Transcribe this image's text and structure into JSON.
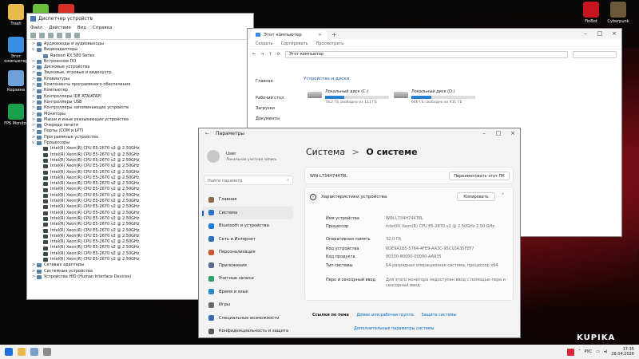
{
  "desktop": {
    "icons_left": [
      {
        "label": "Trash",
        "color": "#e8b84a"
      },
      {
        "label": "",
        "color": "#6bbf3a"
      },
      {
        "label": "",
        "color": "#d93025"
      },
      {
        "label": "Этот компьютер",
        "color": "#3a8ee6"
      },
      {
        "label": "Корзина",
        "color": "#6fa0d8"
      },
      {
        "label": "FPS Monitor",
        "color": "#18a048"
      }
    ],
    "icons_right": [
      {
        "label": "FinBot",
        "color": "#c8141e"
      },
      {
        "label": "Cyberpunk",
        "color": "#6a5a3a"
      }
    ],
    "watermark": "KUPIKA"
  },
  "device_manager": {
    "title": "Диспетчер устройств",
    "menu": [
      "Файл",
      "Действие",
      "Вид",
      "Справка"
    ],
    "tree": [
      {
        "label": "Аудиовходы и аудиовыходы",
        "level": 0,
        "toggle": ">"
      },
      {
        "label": "Видеоадаптеры",
        "level": 0,
        "toggle": "v"
      },
      {
        "label": "Radeon RX 580 Series",
        "level": 1,
        "toggle": ""
      },
      {
        "label": "Встроенное ПО",
        "level": 0,
        "toggle": ">"
      },
      {
        "label": "Дисковые устройства",
        "level": 0,
        "toggle": ">"
      },
      {
        "label": "Звуковые, игровые и видеоустр.",
        "level": 0,
        "toggle": ">"
      },
      {
        "label": "Клавиатуры",
        "level": 0,
        "toggle": ">"
      },
      {
        "label": "Компоненты программного обеспечения",
        "level": 0,
        "toggle": ">"
      },
      {
        "label": "Компьютер",
        "level": 0,
        "toggle": ">"
      },
      {
        "label": "Контроллеры IDE ATA/ATAPI",
        "level": 0,
        "toggle": ">"
      },
      {
        "label": "Контроллеры USB",
        "level": 0,
        "toggle": ">"
      },
      {
        "label": "Контроллеры запоминающих устройств",
        "level": 0,
        "toggle": ">"
      },
      {
        "label": "Мониторы",
        "level": 0,
        "toggle": ">"
      },
      {
        "label": "Мыши и иные указывающие устройства",
        "level": 0,
        "toggle": ">"
      },
      {
        "label": "Очереди печати",
        "level": 0,
        "toggle": ">"
      },
      {
        "label": "Порты (COM и LPT)",
        "level": 0,
        "toggle": ">"
      },
      {
        "label": "Программные устройства",
        "level": 0,
        "toggle": ">"
      },
      {
        "label": "Процессоры",
        "level": 0,
        "toggle": "v"
      }
    ],
    "cpu_label": "Intel(R) Xeon(R) CPU E5-2670 v2 @ 2.50GHz",
    "cpu_count": 20,
    "tail": [
      {
        "label": "Сетевые адаптеры",
        "toggle": ">"
      },
      {
        "label": "Системные устройства",
        "toggle": ">"
      },
      {
        "label": "Устройства HID (Human Interface Devices)",
        "toggle": ">"
      }
    ]
  },
  "explorer": {
    "tab": "Этот компьютер",
    "commands": [
      "Создать",
      "Сортировать",
      "Просмотреть"
    ],
    "address": "Этот компьютер",
    "nav": [
      "Главная",
      "Рабочий стол",
      "Загрузки",
      "Документы"
    ],
    "section": "Устройства и диски",
    "drives": [
      {
        "name": "Локальный диск (C:)",
        "free": "78,2 ГБ свободно из 111 ГБ",
        "used": 0.3
      },
      {
        "name": "Локальный диск (D:)",
        "free": "646 ГБ свободно из 931 ГБ",
        "used": 0.31
      }
    ]
  },
  "settings": {
    "title": "Параметры",
    "user_name": "User",
    "user_sub": "Локальная учетная запись",
    "search_placeholder": "Найти параметр",
    "nav": [
      {
        "label": "Главная",
        "color": "#8a6a4a"
      },
      {
        "label": "Система",
        "color": "#2a73c8"
      },
      {
        "label": "Bluetooth и устройства",
        "color": "#1f7ad6"
      },
      {
        "label": "Сеть и Интернет",
        "color": "#2b6fbf"
      },
      {
        "label": "Персонализация",
        "color": "#c85a2a"
      },
      {
        "label": "Приложения",
        "color": "#5a6a8a"
      },
      {
        "label": "Учетные записи",
        "color": "#2aa06a"
      },
      {
        "label": "Время и язык",
        "color": "#2a8ac8"
      },
      {
        "label": "Игры",
        "color": "#6a6a6a"
      },
      {
        "label": "Специальные возможности",
        "color": "#3a6ab0"
      },
      {
        "label": "Конфиденциальность и защита",
        "color": "#5a5a5a"
      }
    ],
    "breadcrumb_parent": "Система",
    "breadcrumb_sep": ">",
    "breadcrumb_current": "О системе",
    "pc_name": "WIN-L734H74478L",
    "rename_button": "Переименовать этот ПК",
    "specs_title": "Характеристики устройства",
    "copy_button": "Копировать",
    "specs": [
      {
        "key": "Имя устройства",
        "value": "WIN-L734H74478L"
      },
      {
        "key": "Процессор",
        "value": "Intel(R) Xeon(R) CPU E5-2670 v2 @ 2.50GHz   2.50 GHz"
      },
      {
        "key": "Оперативная память",
        "value": "32,0 ГБ"
      },
      {
        "key": "Код устройства",
        "value": "6DE9A1B5-5764-4FE9-AA3C-95C10A35FEF7"
      },
      {
        "key": "Код продукта",
        "value": "00330-80000-00000-AA935"
      },
      {
        "key": "Тип системы",
        "value": "64-разрядная операционная система, процессор x64"
      },
      {
        "key": "Перо и сенсорный ввод",
        "value": "Для этого монитора недоступен ввод с помощью пера и сенсорный ввод"
      }
    ],
    "related_label": "Ссылки по теме",
    "related_links": [
      "Домен или рабочая группа",
      "Защита системы"
    ],
    "advanced_link": "Дополнительные параметры системы"
  },
  "taskbar": {
    "lang": "РУС",
    "time": "17:35",
    "date": "28.04.2026"
  }
}
